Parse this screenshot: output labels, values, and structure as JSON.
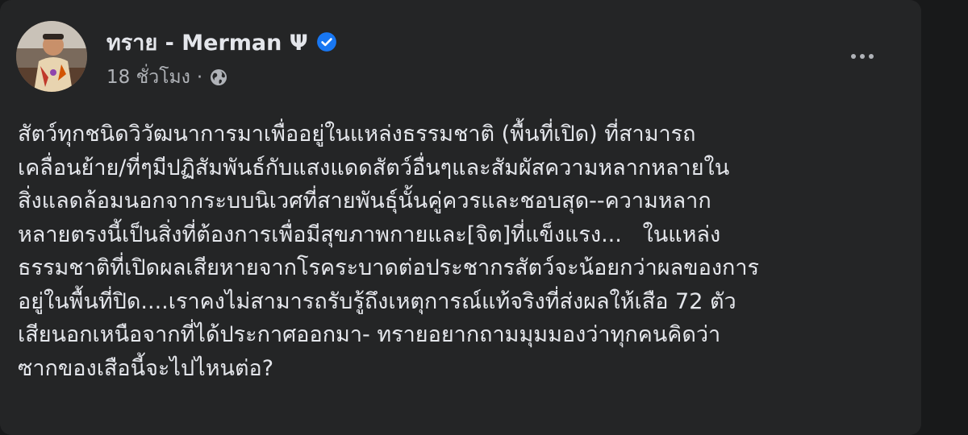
{
  "post": {
    "author_name": "ทราย - Merman Ψ",
    "verified_icon": "verified-badge-icon",
    "timestamp": "18 ชั่วโมง",
    "separator": "·",
    "audience_icon": "globe-icon",
    "more_icon": "more-options-icon",
    "body_lines": [
      "สัตว์ทุกชนิดวิวัฒนาการมาเพื่ออยู่ในแหล่งธรรมชาติ (พื้นที่เปิด) ที่สามารถ",
      "เคลื่อนย้าย/ที่ๆมีปฏิสัมพันธ์กับแสงแดดสัตว์อื่นๆและสัมผัสความหลากหลายใน",
      "สิ่งแลดล้อมนอกจากระบบนิเวศที่สายพันธุ์นั้นคู่ควรและชอบสุด--ความหลาก",
      "หลายตรงนี้เป็นสิ่งที่ต้องการเพื่อมีสุขภาพกายและ[จิต]ที่แข็งแรง...   ในแหล่ง",
      "ธรรมชาติที่เปิดผลเสียหายจากโรคระบาดต่อประชากรสัตว์จะน้อยกว่าผลของการ",
      "อยู่ในพื้นที่ปิด....เราคงไม่สามารถรับรู้ถึงเหตุการณ์แท้จริงที่ส่งผลให้เสือ 72 ตัว",
      "เสียนอกเหนือจากที่ได้ประกาศออกมา- ทรายอยากถามมุมมองว่าทุกคนคิดว่า",
      "ซากของเสือนี้จะไปไหนต่อ?"
    ]
  },
  "colors": {
    "page_background": "#18191a",
    "card_background": "#242526",
    "primary_text": "#e4e6eb",
    "secondary_text": "#b0b3b8",
    "verified_blue": "#1877f2"
  }
}
